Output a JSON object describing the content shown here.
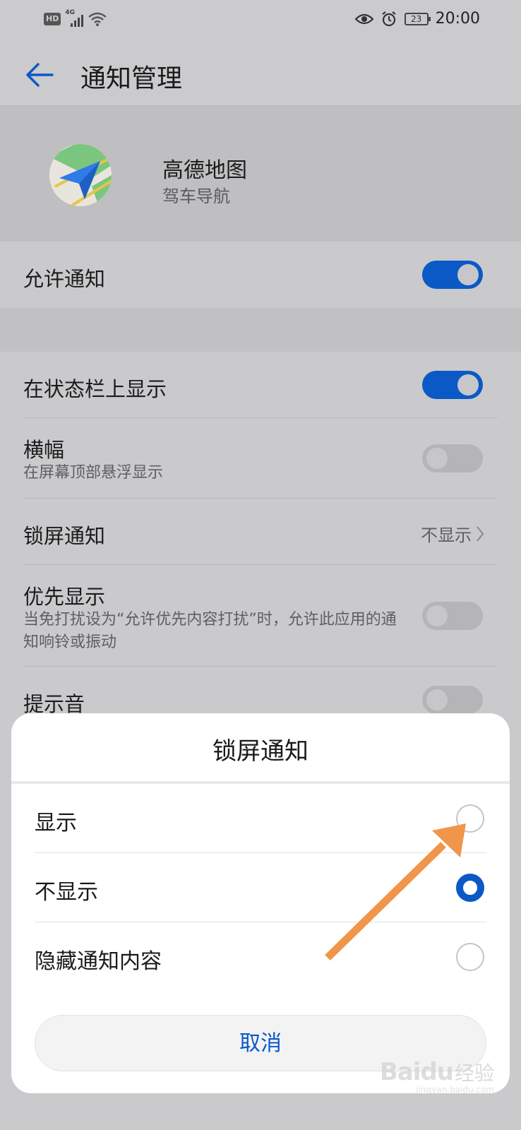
{
  "status_bar": {
    "hd": "HD",
    "network": "4G",
    "battery": "23",
    "time": "20:00",
    "icons": [
      "hd-icon",
      "signal-icon",
      "wifi-icon",
      "eye-comfort-icon",
      "alarm-icon",
      "battery-icon"
    ]
  },
  "header": {
    "title": "通知管理",
    "back_icon": "back-arrow-icon"
  },
  "app": {
    "name": "高德地图",
    "subtitle": "驾车导航",
    "icon": "amap-app-icon"
  },
  "settings": {
    "allow_notifications": {
      "label": "允许通知",
      "on": true
    },
    "status_bar_display": {
      "label": "在状态栏上显示",
      "on": true
    },
    "banner": {
      "label": "横幅",
      "description": "在屏幕顶部悬浮显示",
      "on": false
    },
    "lock_screen": {
      "label": "锁屏通知",
      "value": "不显示"
    },
    "priority": {
      "label": "优先显示",
      "description": "当免打扰设为“允许优先内容打扰”时，允许此应用的通知响铃或振动",
      "on": false
    },
    "sound": {
      "label": "提示音",
      "on": false
    }
  },
  "dialog": {
    "title": "锁屏通知",
    "options": [
      {
        "label": "显示",
        "selected": false
      },
      {
        "label": "不显示",
        "selected": true
      },
      {
        "label": "隐藏通知内容",
        "selected": false
      }
    ],
    "cancel": "取消"
  },
  "annotation": {
    "arrow_color": "#f0954a",
    "points_to": "显示"
  },
  "watermark": {
    "brand": "Baidu",
    "suffix": "经验",
    "url": "jingyan.baidu.com"
  },
  "colors": {
    "accent": "#0a59c7",
    "background": "#cac9cc"
  }
}
